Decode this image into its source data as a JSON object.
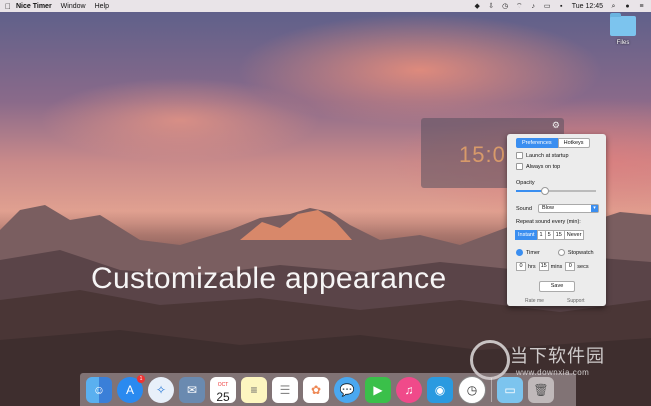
{
  "menubar": {
    "app_name": "Nice Timer",
    "items": [
      "Window",
      "Help"
    ],
    "clock": "Tue 12:45"
  },
  "desktop": {
    "files_label": "Files"
  },
  "timer": {
    "display": "15:0"
  },
  "prefs": {
    "tabs": [
      "Preferences",
      "Hotkeys"
    ],
    "launch_at_startup": "Launch at startup",
    "always_on_top": "Always on top",
    "opacity_label": "Opacity",
    "opacity_value": 0.35,
    "sound_label": "Sound",
    "sound_value": "Blow",
    "repeat_label": "Repeat sound every (min):",
    "repeat_options": [
      "Instant",
      "1",
      "5",
      "15",
      "Never"
    ],
    "mode_timer": "Timer",
    "mode_stopwatch": "Stopwatch",
    "hrs_value": "0",
    "hrs_label": "hrs",
    "mins_value": "15",
    "mins_label": "mins",
    "secs_value": "0",
    "secs_label": "secs",
    "save_label": "Save",
    "rate_label": "Rate me",
    "support_label": "Support"
  },
  "caption": "Customizable appearance",
  "watermark": {
    "line1": "当下软件园",
    "line2": "www.downxia.com"
  },
  "dock": {
    "apps": [
      "finder-icon",
      "app-store-icon",
      "safari-icon",
      "mail-icon",
      "calendar-icon",
      "notes-icon",
      "reminders-icon",
      "photos-icon",
      "messages-icon",
      "facetime-icon",
      "itunes-icon",
      "tweetbot-icon",
      "clock-icon",
      "folder-icon",
      "trash-icon"
    ],
    "calendar_month": "OCT",
    "calendar_day": "25",
    "appstore_badge": "1"
  }
}
